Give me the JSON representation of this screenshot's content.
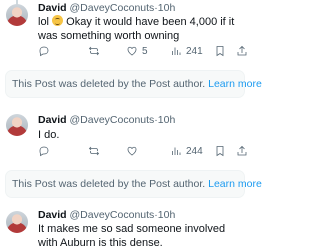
{
  "posts": [
    {
      "name": "David",
      "handle": "@DaveyCoconuts",
      "time": "10h",
      "text_prefix": "lol",
      "text_suffix": "Okay it would have been 4,000 if it was something worth owning",
      "actions": {
        "replies": "",
        "reposts": "",
        "likes": "5",
        "views": "241"
      }
    },
    {
      "name": "David",
      "handle": "@DaveyCoconuts",
      "time": "10h",
      "text": "I do.",
      "actions": {
        "replies": "",
        "reposts": "",
        "likes": "",
        "views": "244"
      }
    },
    {
      "name": "David",
      "handle": "@DaveyCoconuts",
      "time": "10h",
      "text": "It makes me so sad someone involved with Auburn is this dense."
    }
  ],
  "deleted_notice": {
    "message": "This Post was deleted by the Post author.",
    "link": "Learn more"
  },
  "separator": "·",
  "colors": {
    "accent": "#1d9bf0",
    "muted": "#536471",
    "text": "#0f1419"
  },
  "icons": [
    "reply-icon",
    "repost-icon",
    "like-icon",
    "views-icon",
    "bookmark-icon",
    "share-icon",
    "emoji-grin-icon"
  ]
}
